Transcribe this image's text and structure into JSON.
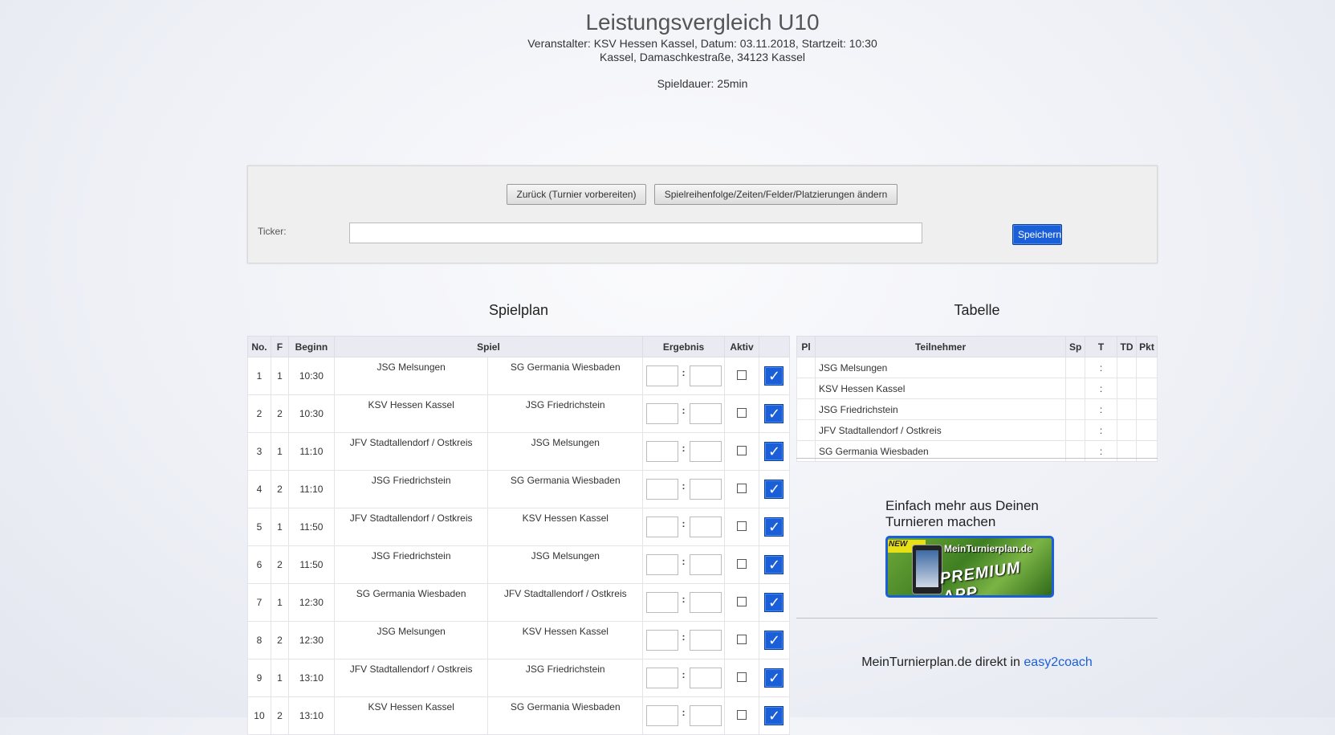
{
  "header": {
    "title": "Leistungsvergleich U10",
    "line1": "Veranstalter: KSV Hessen Kassel, Datum: 03.11.2018, Startzeit: 10:30",
    "line2": "Kassel, Damaschkestraße, 34123 Kassel",
    "duration": "Spieldauer: 25min"
  },
  "toolbar": {
    "back_label": "Zurück (Turnier vorbereiten)",
    "order_label": "Spielreihenfolge/Zeiten/Felder/Platzierungen ändern",
    "ticker_label": "Ticker:",
    "ticker_value": "",
    "save_label": "Speichern"
  },
  "schedule": {
    "title": "Spielplan",
    "headers": [
      "No.",
      "F",
      "Beginn",
      "Spiel",
      "Ergebnis",
      "Aktiv"
    ],
    "rows": [
      {
        "no": "1",
        "field": "1",
        "time": "10:30",
        "home": "JSG Melsungen",
        "away": "SG Germania Wiesbaden"
      },
      {
        "no": "2",
        "field": "2",
        "time": "10:30",
        "home": "KSV Hessen Kassel",
        "away": "JSG Friedrichstein"
      },
      {
        "no": "3",
        "field": "1",
        "time": "11:10",
        "home": "JFV Stadtallendorf / Ostkreis",
        "away": "JSG Melsungen"
      },
      {
        "no": "4",
        "field": "2",
        "time": "11:10",
        "home": "JSG Friedrichstein",
        "away": "SG Germania Wiesbaden"
      },
      {
        "no": "5",
        "field": "1",
        "time": "11:50",
        "home": "JFV Stadtallendorf / Ostkreis",
        "away": "KSV Hessen Kassel"
      },
      {
        "no": "6",
        "field": "2",
        "time": "11:50",
        "home": "JSG Friedrichstein",
        "away": "JSG Melsungen"
      },
      {
        "no": "7",
        "field": "1",
        "time": "12:30",
        "home": "SG Germania Wiesbaden",
        "away": "JFV Stadtallendorf / Ostkreis"
      },
      {
        "no": "8",
        "field": "2",
        "time": "12:30",
        "home": "JSG Melsungen",
        "away": "KSV Hessen Kassel"
      },
      {
        "no": "9",
        "field": "1",
        "time": "13:10",
        "home": "JFV Stadtallendorf / Ostkreis",
        "away": "JSG Friedrichstein"
      },
      {
        "no": "10",
        "field": "2",
        "time": "13:10",
        "home": "KSV Hessen Kassel",
        "away": "SG Germania Wiesbaden"
      }
    ],
    "score_separator": ":",
    "confirm_glyph": "✓"
  },
  "standings": {
    "title": "Tabelle",
    "headers": [
      "Pl",
      "Teilnehmer",
      "Sp",
      "T",
      "TD",
      "Pkt"
    ],
    "rows": [
      {
        "team": "JSG Melsungen",
        "goals": ":"
      },
      {
        "team": "KSV Hessen Kassel",
        "goals": ":"
      },
      {
        "team": "JSG Friedrichstein",
        "goals": ":"
      },
      {
        "team": "JFV Stadtallendorf / Ostkreis",
        "goals": ":"
      },
      {
        "team": "SG Germania Wiesbaden",
        "goals": ":"
      }
    ]
  },
  "promo": {
    "text": "Einfach mehr aus Deinen Turnieren machen",
    "banner_new": "NEW",
    "banner_site": "MeinTurnierplan.de",
    "banner_app": "PREMIUM APP"
  },
  "footer": {
    "text": "MeinTurnierplan.de direkt in ",
    "link": "easy2coach"
  },
  "colors": {
    "accent": "#1a5fd8",
    "header_bg": "#e9eaf2"
  }
}
